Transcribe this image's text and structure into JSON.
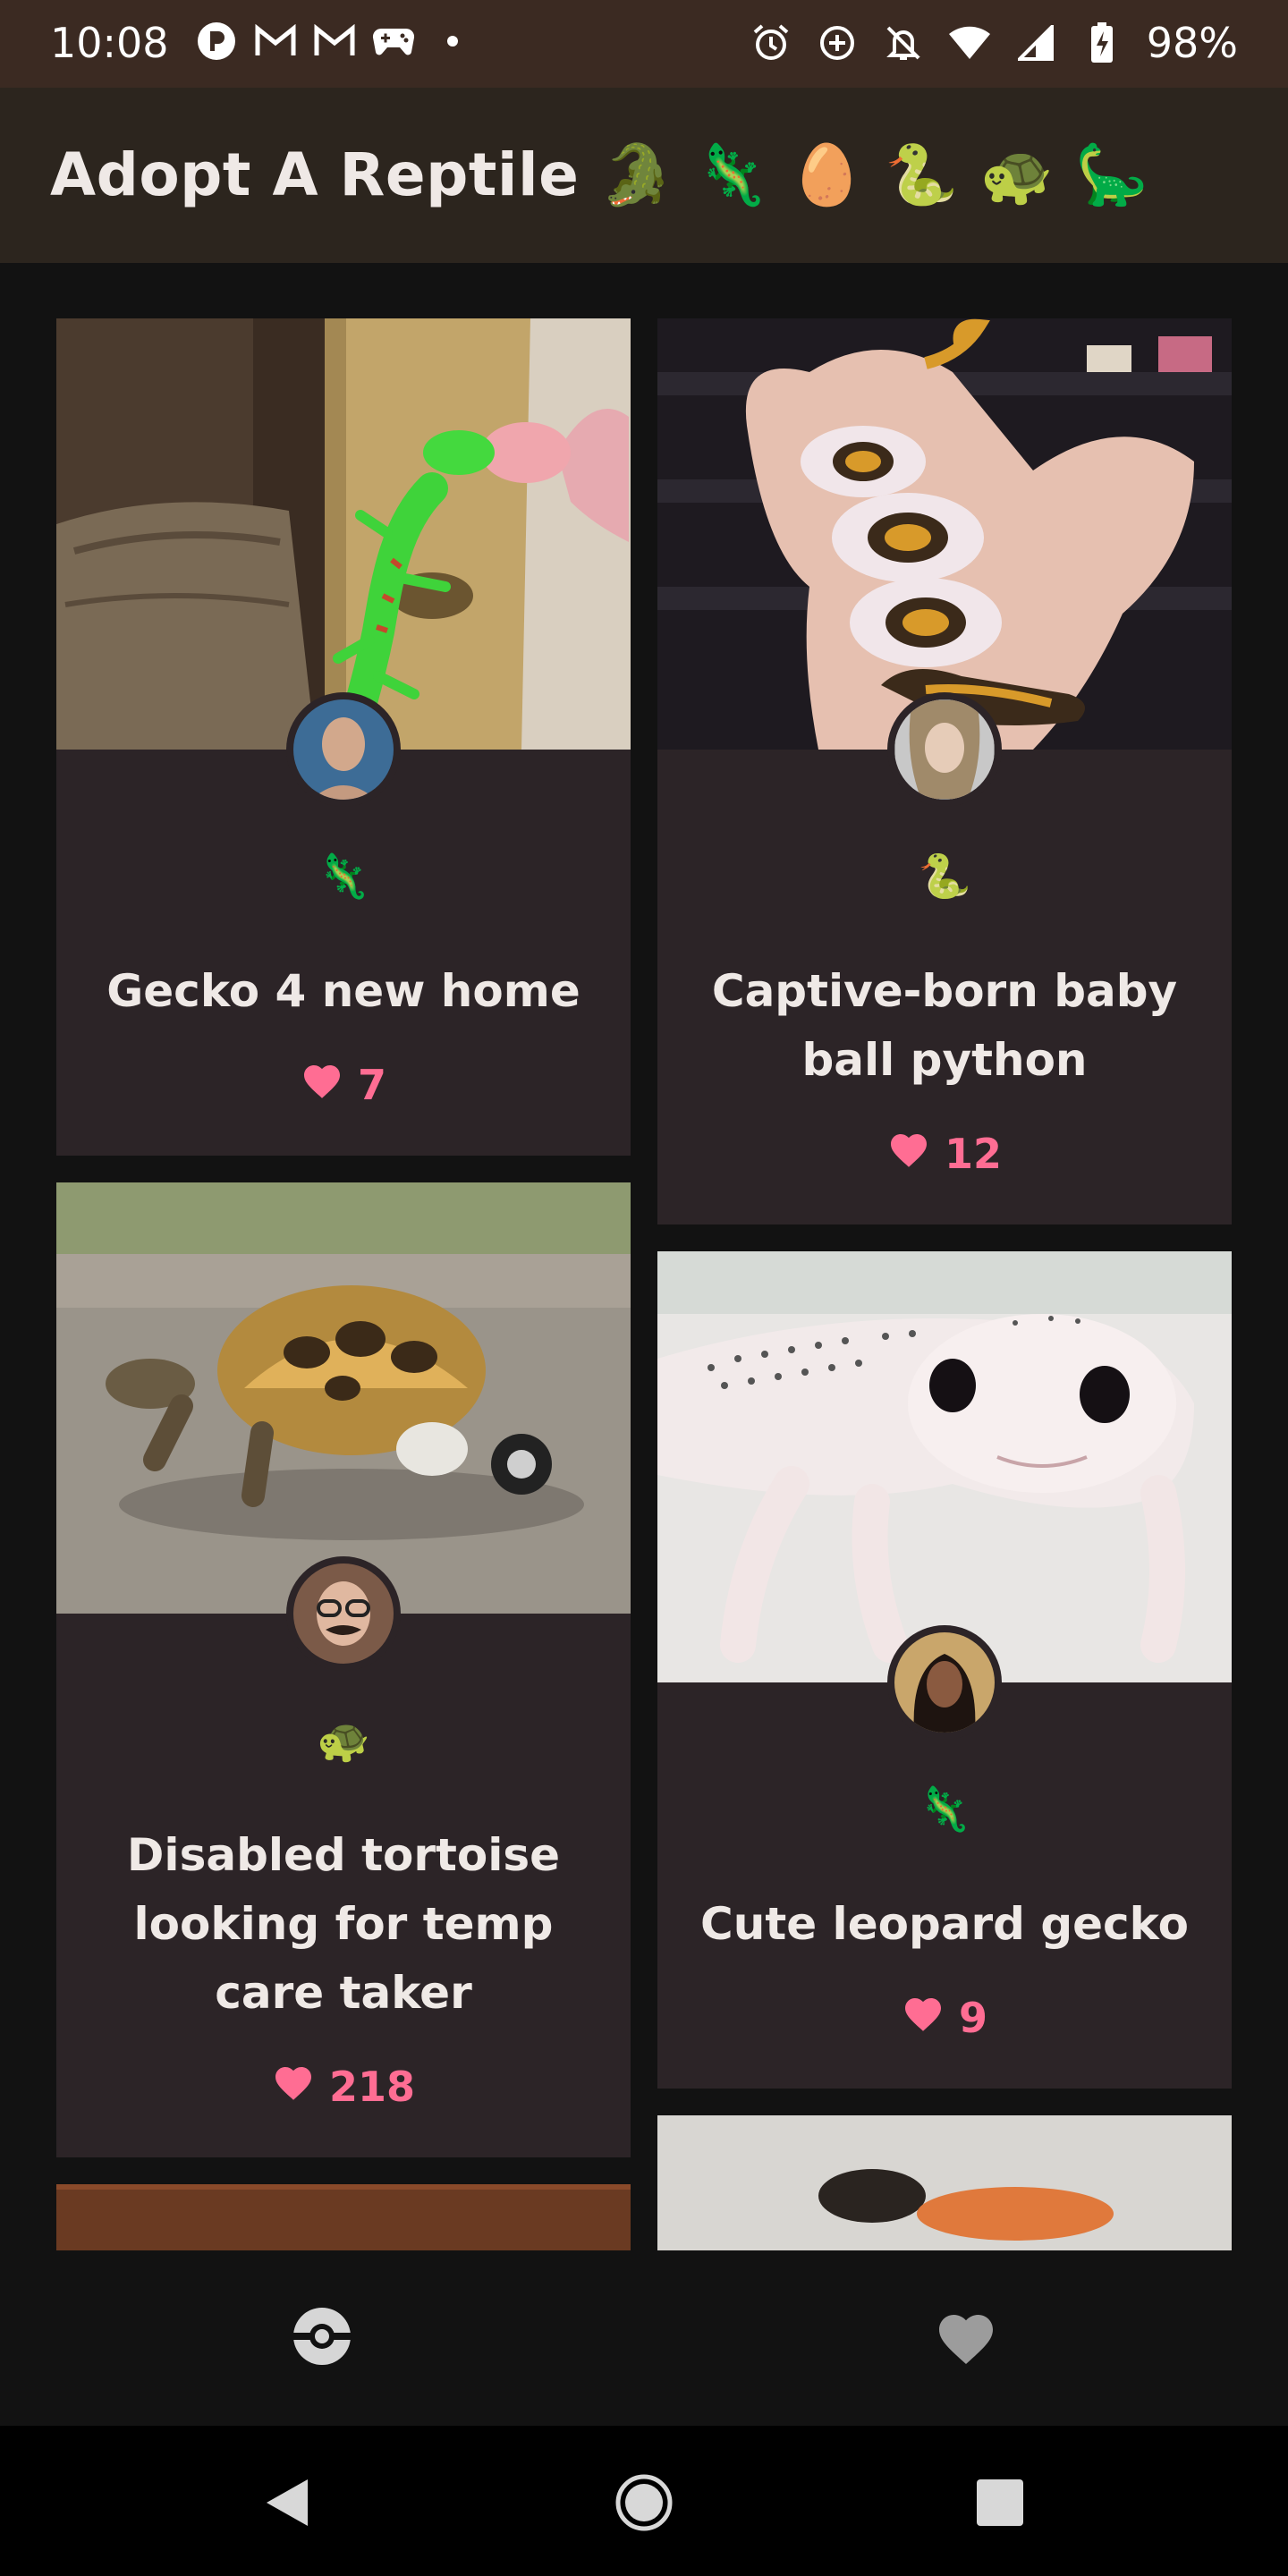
{
  "status_bar": {
    "time": "10:08",
    "battery": "98%",
    "left_icons": [
      "app-p-icon",
      "gmail-icon",
      "gmail-icon",
      "gamepad-icon",
      "dot-icon"
    ],
    "right_icons": [
      "alarm-icon",
      "data-saver-icon",
      "notifications-off-icon",
      "wifi-icon",
      "signal-icon",
      "battery-charging-icon"
    ]
  },
  "app_bar": {
    "title": "Adopt A Reptile 🐊 🦎 🥚 🐍 🐢 🦕"
  },
  "cards": [
    {
      "title": "Gecko 4 new home",
      "emoji": "🦎",
      "likes": "7",
      "photo": "green day gecko on bamboo"
    },
    {
      "title": "Captive-born baby ball python",
      "emoji": "🐍",
      "likes": "12",
      "photo": "ball python in hand"
    },
    {
      "title": "Disabled tortoise looking for temp care taker",
      "emoji": "🐢",
      "likes": "218",
      "photo": "tortoise with wheel"
    },
    {
      "title": "Cute leopard gecko",
      "emoji": "🦎",
      "likes": "9",
      "photo": "leopard gecko close-up"
    }
  ],
  "bottom_nav": {
    "tabs": [
      {
        "name": "browse",
        "icon": "pokeball-icon",
        "active": true
      },
      {
        "name": "favorites",
        "icon": "heart-icon",
        "active": false
      }
    ]
  },
  "colors": {
    "status_bar": "#3b2a22",
    "app_bar": "#2c251e",
    "background": "#121212",
    "card": "#2c2427",
    "like": "#ff6d93"
  }
}
